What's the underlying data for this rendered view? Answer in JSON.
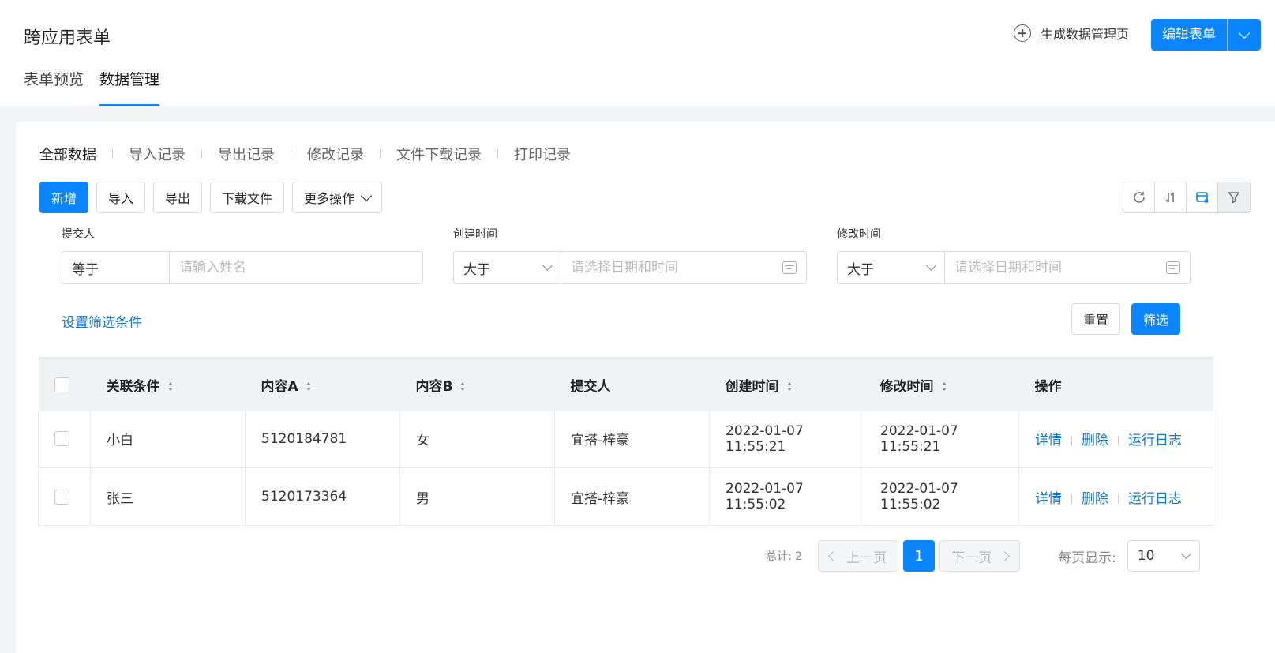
{
  "header": {
    "app_title": "跨应用表单",
    "generate_page_label": "生成数据管理页",
    "edit_form_label": "编辑表单",
    "tabs": [
      {
        "label": "表单预览",
        "active": false
      },
      {
        "label": "数据管理",
        "active": true
      }
    ]
  },
  "subtabs": [
    "全部数据",
    "导入记录",
    "导出记录",
    "修改记录",
    "文件下载记录",
    "打印记录"
  ],
  "toolbar": {
    "add": "新增",
    "import": "导入",
    "export": "导出",
    "download": "下载文件",
    "more": "更多操作",
    "icons": [
      "refresh-icon",
      "sort-icon",
      "column-settings-icon",
      "filter-icon"
    ]
  },
  "filters": [
    {
      "label": "提交人",
      "operator": "等于",
      "placeholder": "请输入姓名"
    },
    {
      "label": "创建时间",
      "operator": "大于",
      "placeholder": "请选择日期和时间"
    },
    {
      "label": "修改时间",
      "operator": "大于",
      "placeholder": "请选择日期和时间"
    }
  ],
  "filter_actions": {
    "set_conditions": "设置筛选条件",
    "reset": "重置",
    "apply": "筛选"
  },
  "table": {
    "columns": [
      "关联条件",
      "内容A",
      "内容B",
      "提交人",
      "创建时间",
      "修改时间",
      "操作"
    ],
    "rows": [
      {
        "cond": "小白",
        "a": "5120184781",
        "b": "女",
        "submitter": "宜搭-梓豪",
        "created": "2022-01-07 11:55:21",
        "modified": "2022-01-07 11:55:21"
      },
      {
        "cond": "张三",
        "a": "5120173364",
        "b": "男",
        "submitter": "宜搭-梓豪",
        "created": "2022-01-07 11:55:02",
        "modified": "2022-01-07 11:55:02"
      }
    ],
    "actions": [
      "详情",
      "删除",
      "运行日志"
    ]
  },
  "pager": {
    "total": "总计: 2",
    "prev": "上一页",
    "next": "下一页",
    "current": "1",
    "per_page_label": "每页显示:",
    "per_page": "10"
  },
  "colors": {
    "accent": "#0a84ff",
    "link": "#1677d2"
  }
}
